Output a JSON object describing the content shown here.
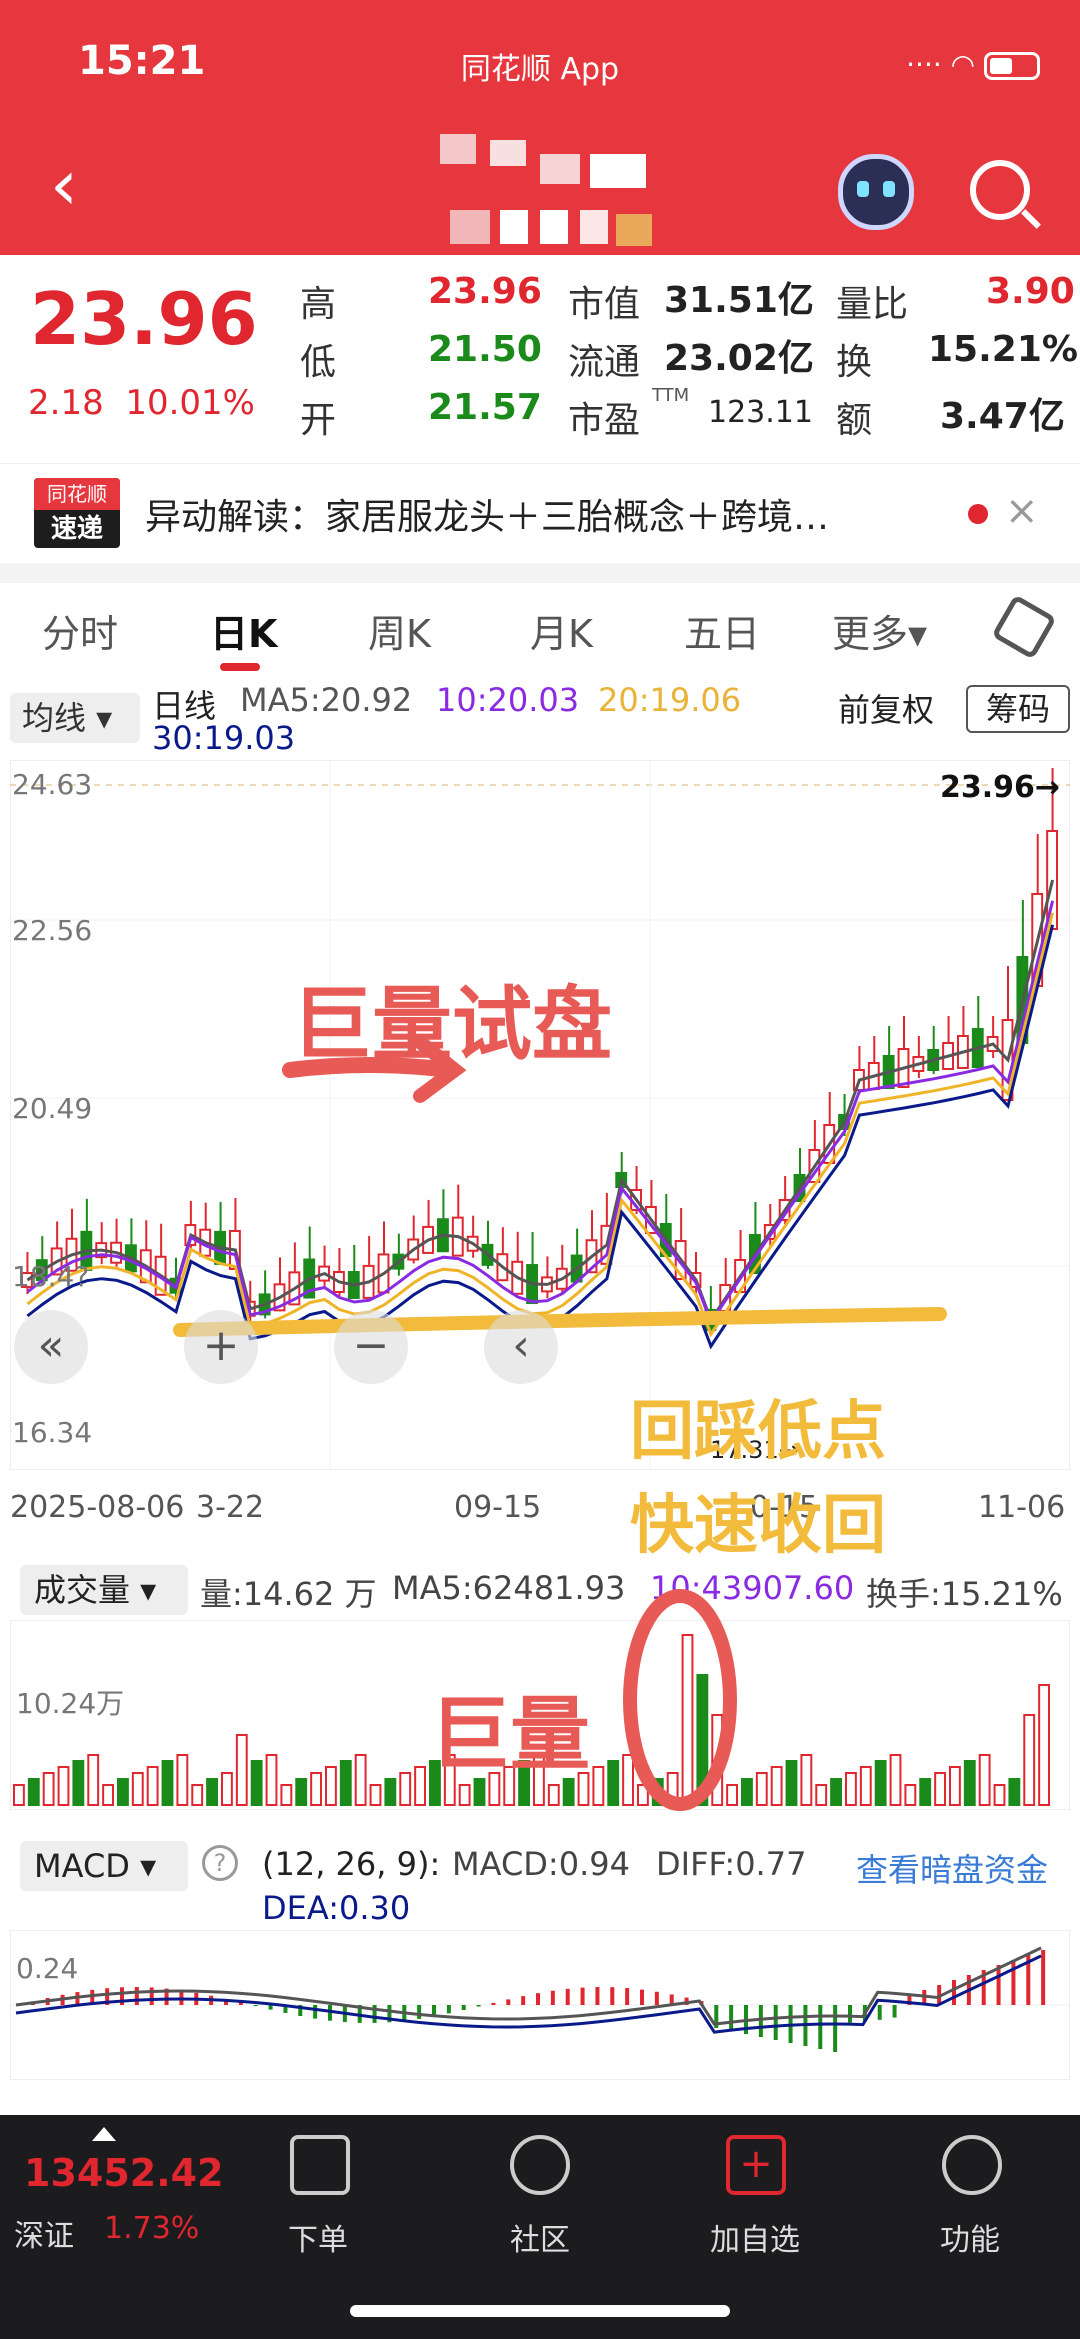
{
  "status": {
    "time": "15:21",
    "app_label": "同花顺 App"
  },
  "quote": {
    "price": "23.96",
    "change": "2.18",
    "change_pct": "10.01%",
    "high_label": "高",
    "high": "23.96",
    "low_label": "低",
    "low": "21.50",
    "open_label": "开",
    "open": "21.57",
    "mcap_label": "市值",
    "mcap": "31.51亿",
    "float_label": "流通",
    "float": "23.02亿",
    "pe_label": "市盈",
    "pe_sup": "TTM",
    "pe": "123.11",
    "vr_label": "量比",
    "vr": "3.90",
    "turn_label": "换",
    "turn": "15.21%",
    "amt_label": "额",
    "amt": "3.47亿"
  },
  "news": {
    "logo_top": "同花顺",
    "logo_bottom": "速递",
    "text": "异动解读：家居服龙头＋三胎概念＋跨境…",
    "close": "×"
  },
  "tabs": [
    {
      "label": "分时"
    },
    {
      "label": "日K"
    },
    {
      "label": "周K"
    },
    {
      "label": "月K"
    },
    {
      "label": "五日"
    },
    {
      "label": "更多▾"
    }
  ],
  "ma_row": {
    "avg_btn": "均线 ▾",
    "line": "日线",
    "ma5": "MA5:20.92",
    "ma10": "10:20.03",
    "ma20": "20:19.06",
    "ma30": "30:19.03",
    "adjust": "前复权",
    "chip": "筹码"
  },
  "kline": {
    "y_labels": [
      "24.63",
      "22.56",
      "20.49",
      "18.4?",
      "16.34"
    ],
    "last_price_tag": "23.96→",
    "low_tag": "17.31→",
    "x_labels": [
      "2025-08-06",
      "3-22",
      "09-15",
      "0-15",
      "11-06"
    ],
    "annotation_1": "巨量试盘",
    "annotation_2": "回踩低点",
    "annotation_3": "快速收回"
  },
  "volume": {
    "select": "成交量 ▾",
    "vol": "量:14.62 万",
    "ma5": "MA5:62481.93",
    "ma10": "10:43907.60",
    "turn": "换手:15.21%",
    "y_label": "10.24万",
    "annotation": "巨量"
  },
  "macd": {
    "select": "MACD ▾",
    "help": "?",
    "params": "(12, 26, 9):",
    "macd": "MACD:0.94",
    "diff": "DIFF:0.77",
    "dea": "DEA:0.30",
    "link": "查看暗盘资金",
    "y_label": "0.24"
  },
  "bottom": {
    "index_value": "13452.42",
    "index_name": "深证",
    "index_pct": "1.73%",
    "items": [
      {
        "label": "下单"
      },
      {
        "label": "社区"
      },
      {
        "label": "加自选"
      },
      {
        "label": "功能"
      }
    ]
  },
  "colors": {
    "header": "#e5373d",
    "up": "#e0262e",
    "down": "#1a8a1a",
    "ma5": "#555555",
    "ma10": "#8a2be2",
    "ma20": "#f0b429",
    "ma30": "#0a1a8a"
  }
}
